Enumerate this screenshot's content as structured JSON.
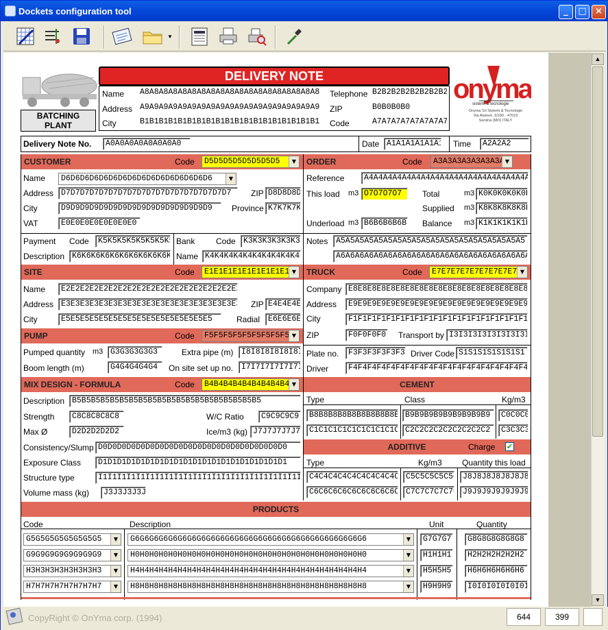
{
  "window": {
    "title": "Dockets configuration tool",
    "min": "_",
    "max": "□",
    "close": "×"
  },
  "header": {
    "title": "DELIVERY NOTE",
    "plant_label": "BATCHING PLANT",
    "name_label": "Name",
    "name": "A8A8A8A8A8A8A8A8A8A8A8A8A8A8A8A8A8A8A8",
    "address_label": "Address",
    "address": "A9A9A9A9A9A9A9A9A9A9A9A9A9A9A9A9A9A9A9",
    "city_label": "City",
    "city": "B1B1B1B1B1B1B1B1B1B1B1B1B1B1B1B1B1B1B1",
    "telephone_label": "Telephone",
    "telephone": "B2B2B2B2B2B2B2B2",
    "zip_label": "ZIP",
    "zip": "B0B0B0B0",
    "code_label": "Code",
    "code": "A7A7A7A7A7A7A7A7",
    "logo": "onyma",
    "logo_sub": "sistemi & tecnologie",
    "logo_addr1": "Onyma Srl Sistemi & Tecnologie",
    "logo_addr2": "Via Alamon, 6/180 - 47019",
    "logo_addr3": "Sarsina (MO) ITALY"
  },
  "note": {
    "label": "Delivery Note No.",
    "value": "A0A0A0A0A0A0A0A0",
    "date_label": "Date",
    "date": "A1A1A1A1A1A1",
    "time_label": "Time",
    "time": "A2A2A2"
  },
  "customer": {
    "title": "CUSTOMER",
    "code_label": "Code",
    "code": "D5D5D5D5D5D5D5D5",
    "name_label": "Name",
    "name": "D6D6D6D6D6D6D6D6D6D6D6D6D6D6D6D6",
    "address_label": "Address",
    "address": "D7D7D7D7D7D7D7D7D7D7D7D7D7D7D7D7D7D7",
    "zip_label": "ZIP",
    "zip": "D8D8D8D8",
    "city_label": "City",
    "city": "D9D9D9D9D9D9D9D9D9D9D9D9D9D9D9D9",
    "province_label": "Province",
    "province": "K7K7K7K7",
    "vat_label": "VAT",
    "vat": "E0E0E0E0E0E0E0E0",
    "payment_label": "Payment",
    "pcode_label": "Code",
    "pcode": "K5K5K5K5K5K5K5K5",
    "desc_label": "Description",
    "desc": "K6K6K6K6K6K6K6K6K6K6K6K6",
    "bank_label": "Bank",
    "bcode_label": "Code",
    "bcode": "K3K3K3K3K3K3K3",
    "bname_label": "Name",
    "bname": "K4K4K4K4K4K4K4K4K4K4K4"
  },
  "order": {
    "title": "ORDER",
    "code_label": "Code",
    "code": "A3A3A3A3A3A3A3A3",
    "ref_label": "Reference",
    "ref": "A4A4A4A4A4A4A4A4A4A4A4A4A4A4A4A4A4A4A4A4",
    "thisload_label": "This load",
    "m3": "m3",
    "thisload": "O7O7O7O7",
    "total_label": "Total",
    "total": "K0K0K0K0K0K0",
    "supplied_label": "Supplied",
    "supplied": "K8K8K8K8K8K8",
    "underload_label": "Underload",
    "underload": "B6B6B6B6B6B6",
    "balance_label": "Balance",
    "balance": "K1K1K1K1K1K1",
    "notes_label": "Notes",
    "notes1": "A5A5A5A5A5A5A5A5A5A5A5A5A5A5A5A5A5A5A5A5",
    "notes2": "A6A6A6A6A6A6A6A6A6A6A6A6A6A6A6A6A6A6A6A6A6"
  },
  "site": {
    "title": "SITE",
    "code_label": "Code",
    "code": "E1E1E1E1E1E1E1E1E1E1",
    "name_label": "Name",
    "name": "E2E2E2E2E2E2E2E2E2E2E2E2E2E2E2E2E2E2E2",
    "address_label": "Address",
    "address": "E3E3E3E3E3E3E3E3E3E3E3E3E3E3E3E3E3E3E3",
    "zip_label": "ZIP",
    "zip": "E4E4E4E4",
    "city_label": "City",
    "city": "E5E5E5E5E5E5E5E5E5E5E5E5E5E5E5E5",
    "radial_label": "Radial",
    "radial": "E6E6E6E6"
  },
  "truck": {
    "title": "TRUCK",
    "code_label": "Code",
    "code": "E7E7E7E7E7E7E7E7E7E7",
    "company_label": "Company",
    "company": "E8E8E8E8E8E8E8E8E8E8E8E8E8E8E8E8E8E8E8E8",
    "address_label": "Address",
    "address": "E9E9E9E9E9E9E9E9E9E9E9E9E9E9E9E9E9E9E9E9",
    "city_label": "City",
    "city": "F1F1F1F1F1F1F1F1F1F1F1F1F1F1F1F1F1F1F1F1",
    "zip_label": "ZIP",
    "zip": "F0F0F0F0",
    "transport_label": "Transport by",
    "transport": "I3I3I3I3I3I3I3I3I3I3I3I3",
    "plate_label": "Plate no.",
    "plate": "F3F3F3F3F3F3",
    "driver_code_label": "Driver Code",
    "driver_code": "S1S1S1S1S1S1S1",
    "driver_label": "Driver",
    "driver": "F4F4F4F4F4F4F4F4F4F4F4F4F4F4F4F4F4F4F4F4"
  },
  "pump": {
    "title": "PUMP",
    "code_label": "Code",
    "code": "F5F5F5F5F5F5F5F5F5F5",
    "pumped_label": "Pumped quantity",
    "m3": "m3",
    "pumped": "G3G3G3G3G3",
    "extra_label": "Extra pipe (m)",
    "extra": "I8I8I8I8I8I8I8I8",
    "boom_label": "Boom length (m)",
    "boom": "G4G4G4G4G4",
    "onsite_label": "On site set up no.",
    "onsite": "I7I7I7I7I7I7I7I7"
  },
  "mix": {
    "title": "MIX DESIGN - FORMULA",
    "code_label": "Code",
    "code": "B4B4B4B4B4B4B4B4B4B4",
    "desc_label": "Description",
    "desc": "B5B5B5B5B5B5B5B5B5B5B5B5B5B5B5B5B5B5B5B5",
    "strength_label": "Strength",
    "strength": "C8C8C8C8C8",
    "wc_label": "W/C Ratio",
    "wc": "C9C9C9C9",
    "max_label": "Max Ø",
    "max": "D2D2D2D2D2",
    "ice_label": "Ice/m3  (kg)",
    "ice": "J7J7J7J7J7J7",
    "cons_label": "Consistency/Slump",
    "cons": "D0D0D0D0D0D0D0D0D0D0D0D0D0D0D0D0D0D0D0D0",
    "exp_label": "Exposure Class",
    "exp": "D1D1D1D1D1D1D1D1D1D1D1D1D1D1D1D1D1D1D1D1",
    "struct_label": "Structure type",
    "struct": "I1I1I1I1I1I1I1I1I1I1I1I1I1I1I1I1I1I1I1I1I1I1",
    "vol_label": "Volume mass (kg)",
    "vol": "J3J3J3J3J3"
  },
  "cement": {
    "title": "CEMENT",
    "type_label": "Type",
    "class_label": "Class",
    "kg_label": "Kg/m3",
    "rows": [
      {
        "type": "B8B8B8B8B8B8B8B8B8B8",
        "class": "B9B9B9B9B9B9B9B9B9",
        "kg": "C0C0C0C0"
      },
      {
        "type": "C1C1C1C1C1C1C1C1C1C1",
        "class": "C2C2C2C2C2C2C2C2C2",
        "kg": "C3C3C3C3"
      }
    ]
  },
  "additive": {
    "title": "ADDITIVE",
    "charge_label": "Charge",
    "check": "✔",
    "type_label": "Type",
    "kg_label": "Kg/m3",
    "qty_label": "Quantity this load",
    "rows": [
      {
        "type": "C4C4C4C4C4C4C4C4C4C4",
        "kg": "C5C5C5C5C5C5",
        "qty": "J8J8J8J8J8J8J8J8"
      },
      {
        "type": "C6C6C6C6C6C6C6C6C6C6",
        "kg": "C7C7C7C7C7C7",
        "qty": "J9J9J9J9J9J9J9J9"
      }
    ]
  },
  "products": {
    "title": "PRODUCTS",
    "code_label": "Code",
    "desc_label": "Description",
    "unit_label": "Unit",
    "qty_label": "Quantity",
    "rows": [
      {
        "code": "G5G5G5G5G5G5G5G5",
        "desc": "G6G6G6G6G6G6G6G6G6G6G6G6G6G6G6G6G6G6G6G6G6G6G6G6G6",
        "unit": "G7G7G7",
        "qty": "G8G8G8G8G8G8"
      },
      {
        "code": "G9G9G9G9G9G9G9G9",
        "desc": "H0H0H0H0H0H0H0H0H0H0H0H0H0H0H0H0H0H0H0H0H0H0H0H0H0",
        "unit": "H1H1H1",
        "qty": "H2H2H2H2H2H2"
      },
      {
        "code": "H3H3H3H3H3H3H3H3",
        "desc": "H4H4H4H4H4H4H4H4H4H4H4H4H4H4H4H4H4H4H4H4H4H4H4H4H4",
        "unit": "H5H5H5",
        "qty": "H6H6H6H6H6H6"
      },
      {
        "code": "H7H7H7H7H7H7H7H7",
        "desc": "H8H8H8H8H8H8H8H8H8H8H8H8H8H8H8H8H8H8H8H8H8H8H8H8H8",
        "unit": "H9H9H9",
        "qty": "I0I0I0I0I0I0I0"
      }
    ]
  },
  "statusbar": {
    "copyright": "CopyRight © OnYma corp. (1994)",
    "x": "644",
    "y": "399"
  }
}
